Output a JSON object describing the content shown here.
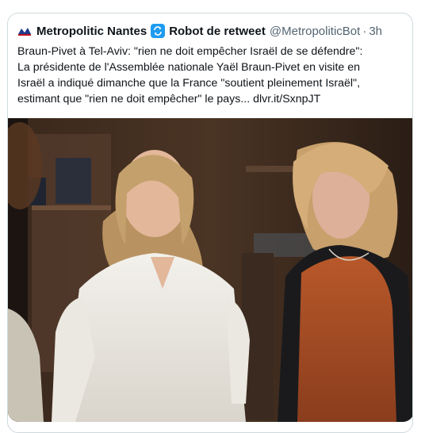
{
  "tweet": {
    "display_name": "Metropolitic Nantes",
    "badge_label": "Robot de retweet",
    "handle": "@MetropoliticBot",
    "separator": "·",
    "timestamp": "3h",
    "avatar_icon": "metropolitic-logo-icon",
    "badge_icon": "refresh-icon",
    "text_main": "Braun-Pivet à Tel-Aviv: \"rien ne doit empêcher Israël de se défendre\":\nLa présidente de l'Assemblée nationale Yaël Braun-Pivet en visite en\nIsraël a indiqué dimanche que la France \"soutient pleinement Israël\",\nestimant que \"rien ne doit empêcher\" le pays... ",
    "link": "dlvr.it/SxnpJT"
  },
  "colors": {
    "text": "#0f1419",
    "muted": "#536471",
    "border": "#cfd9de",
    "accent": "#1d9bf0"
  }
}
